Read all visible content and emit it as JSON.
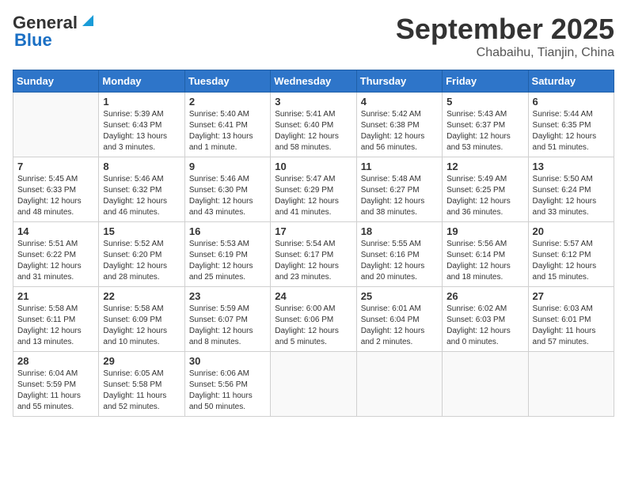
{
  "logo": {
    "line1": "General",
    "line2": "Blue"
  },
  "header": {
    "month": "September 2025",
    "location": "Chabaihu, Tianjin, China"
  },
  "weekdays": [
    "Sunday",
    "Monday",
    "Tuesday",
    "Wednesday",
    "Thursday",
    "Friday",
    "Saturday"
  ],
  "weeks": [
    [
      {
        "day": "",
        "info": ""
      },
      {
        "day": "1",
        "info": "Sunrise: 5:39 AM\nSunset: 6:43 PM\nDaylight: 13 hours\nand 3 minutes."
      },
      {
        "day": "2",
        "info": "Sunrise: 5:40 AM\nSunset: 6:41 PM\nDaylight: 13 hours\nand 1 minute."
      },
      {
        "day": "3",
        "info": "Sunrise: 5:41 AM\nSunset: 6:40 PM\nDaylight: 12 hours\nand 58 minutes."
      },
      {
        "day": "4",
        "info": "Sunrise: 5:42 AM\nSunset: 6:38 PM\nDaylight: 12 hours\nand 56 minutes."
      },
      {
        "day": "5",
        "info": "Sunrise: 5:43 AM\nSunset: 6:37 PM\nDaylight: 12 hours\nand 53 minutes."
      },
      {
        "day": "6",
        "info": "Sunrise: 5:44 AM\nSunset: 6:35 PM\nDaylight: 12 hours\nand 51 minutes."
      }
    ],
    [
      {
        "day": "7",
        "info": "Sunrise: 5:45 AM\nSunset: 6:33 PM\nDaylight: 12 hours\nand 48 minutes."
      },
      {
        "day": "8",
        "info": "Sunrise: 5:46 AM\nSunset: 6:32 PM\nDaylight: 12 hours\nand 46 minutes."
      },
      {
        "day": "9",
        "info": "Sunrise: 5:46 AM\nSunset: 6:30 PM\nDaylight: 12 hours\nand 43 minutes."
      },
      {
        "day": "10",
        "info": "Sunrise: 5:47 AM\nSunset: 6:29 PM\nDaylight: 12 hours\nand 41 minutes."
      },
      {
        "day": "11",
        "info": "Sunrise: 5:48 AM\nSunset: 6:27 PM\nDaylight: 12 hours\nand 38 minutes."
      },
      {
        "day": "12",
        "info": "Sunrise: 5:49 AM\nSunset: 6:25 PM\nDaylight: 12 hours\nand 36 minutes."
      },
      {
        "day": "13",
        "info": "Sunrise: 5:50 AM\nSunset: 6:24 PM\nDaylight: 12 hours\nand 33 minutes."
      }
    ],
    [
      {
        "day": "14",
        "info": "Sunrise: 5:51 AM\nSunset: 6:22 PM\nDaylight: 12 hours\nand 31 minutes."
      },
      {
        "day": "15",
        "info": "Sunrise: 5:52 AM\nSunset: 6:20 PM\nDaylight: 12 hours\nand 28 minutes."
      },
      {
        "day": "16",
        "info": "Sunrise: 5:53 AM\nSunset: 6:19 PM\nDaylight: 12 hours\nand 25 minutes."
      },
      {
        "day": "17",
        "info": "Sunrise: 5:54 AM\nSunset: 6:17 PM\nDaylight: 12 hours\nand 23 minutes."
      },
      {
        "day": "18",
        "info": "Sunrise: 5:55 AM\nSunset: 6:16 PM\nDaylight: 12 hours\nand 20 minutes."
      },
      {
        "day": "19",
        "info": "Sunrise: 5:56 AM\nSunset: 6:14 PM\nDaylight: 12 hours\nand 18 minutes."
      },
      {
        "day": "20",
        "info": "Sunrise: 5:57 AM\nSunset: 6:12 PM\nDaylight: 12 hours\nand 15 minutes."
      }
    ],
    [
      {
        "day": "21",
        "info": "Sunrise: 5:58 AM\nSunset: 6:11 PM\nDaylight: 12 hours\nand 13 minutes."
      },
      {
        "day": "22",
        "info": "Sunrise: 5:58 AM\nSunset: 6:09 PM\nDaylight: 12 hours\nand 10 minutes."
      },
      {
        "day": "23",
        "info": "Sunrise: 5:59 AM\nSunset: 6:07 PM\nDaylight: 12 hours\nand 8 minutes."
      },
      {
        "day": "24",
        "info": "Sunrise: 6:00 AM\nSunset: 6:06 PM\nDaylight: 12 hours\nand 5 minutes."
      },
      {
        "day": "25",
        "info": "Sunrise: 6:01 AM\nSunset: 6:04 PM\nDaylight: 12 hours\nand 2 minutes."
      },
      {
        "day": "26",
        "info": "Sunrise: 6:02 AM\nSunset: 6:03 PM\nDaylight: 12 hours\nand 0 minutes."
      },
      {
        "day": "27",
        "info": "Sunrise: 6:03 AM\nSunset: 6:01 PM\nDaylight: 11 hours\nand 57 minutes."
      }
    ],
    [
      {
        "day": "28",
        "info": "Sunrise: 6:04 AM\nSunset: 5:59 PM\nDaylight: 11 hours\nand 55 minutes."
      },
      {
        "day": "29",
        "info": "Sunrise: 6:05 AM\nSunset: 5:58 PM\nDaylight: 11 hours\nand 52 minutes."
      },
      {
        "day": "30",
        "info": "Sunrise: 6:06 AM\nSunset: 5:56 PM\nDaylight: 11 hours\nand 50 minutes."
      },
      {
        "day": "",
        "info": ""
      },
      {
        "day": "",
        "info": ""
      },
      {
        "day": "",
        "info": ""
      },
      {
        "day": "",
        "info": ""
      }
    ]
  ]
}
